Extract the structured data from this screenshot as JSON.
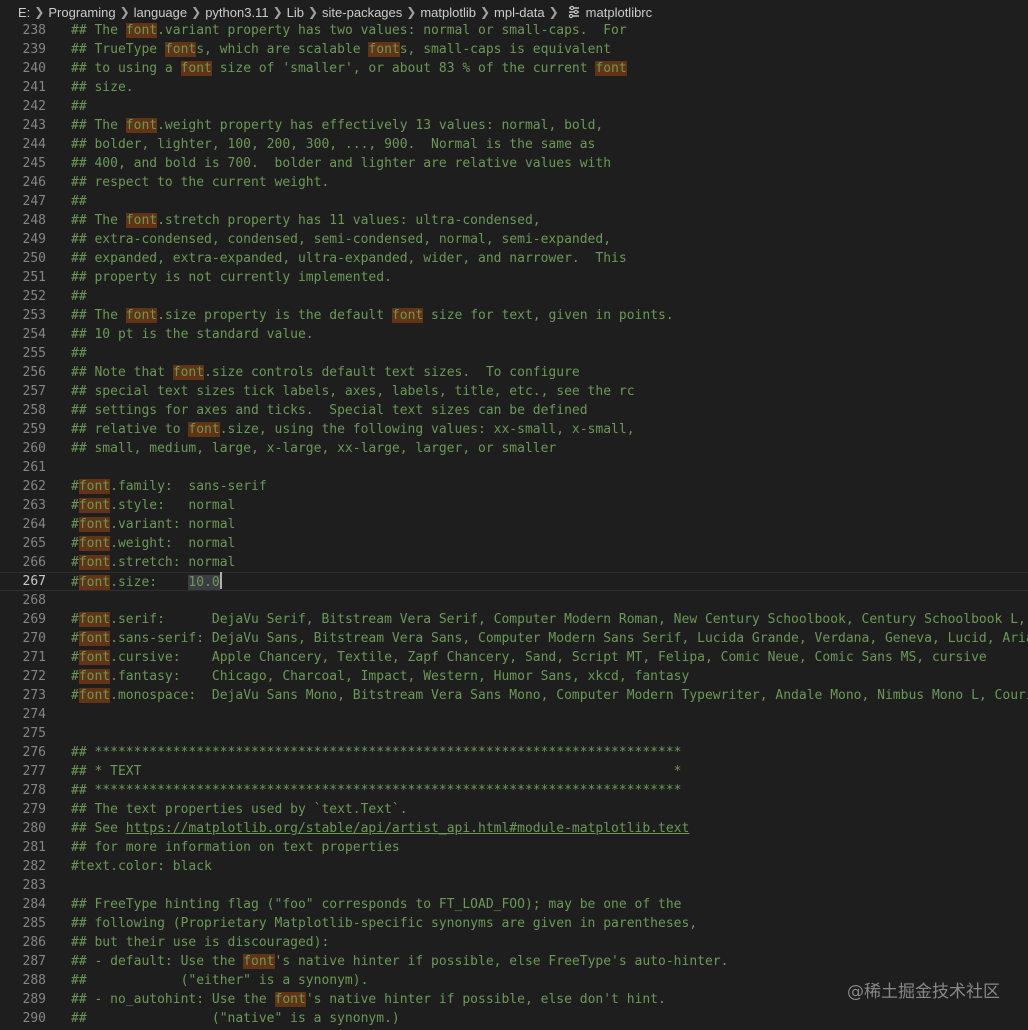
{
  "breadcrumb": {
    "items": [
      "E:",
      "Programing",
      "language",
      "python3.11",
      "Lib",
      "site-packages",
      "matplotlib",
      "mpl-data",
      "matplotlibrc"
    ]
  },
  "editor": {
    "current_line": 267,
    "lines": [
      {
        "n": 238,
        "segs": [
          [
            "## The "
          ],
          [
            "font",
            "hl"
          ],
          [
            ".variant property has two values: normal or small-caps.  For"
          ]
        ]
      },
      {
        "n": 239,
        "segs": [
          [
            "## TrueType "
          ],
          [
            "font",
            "hl"
          ],
          [
            "s, which are scalable "
          ],
          [
            "font",
            "hl"
          ],
          [
            "s, small-caps is equivalent"
          ]
        ]
      },
      {
        "n": 240,
        "segs": [
          [
            "## to using a "
          ],
          [
            "font",
            "hl"
          ],
          [
            " size of 'smaller', or about 83 % of the current "
          ],
          [
            "font",
            "hl"
          ]
        ]
      },
      {
        "n": 241,
        "segs": [
          [
            "## size."
          ]
        ],
        "mark": true
      },
      {
        "n": 242,
        "segs": [
          [
            "##"
          ]
        ]
      },
      {
        "n": 243,
        "segs": [
          [
            "## The "
          ],
          [
            "font",
            "hl"
          ],
          [
            ".weight property has effectively 13 values: normal, bold,"
          ]
        ]
      },
      {
        "n": 244,
        "segs": [
          [
            "## bolder, lighter, 100, 200, 300, ..., 900.  Normal is the same as"
          ]
        ]
      },
      {
        "n": 245,
        "segs": [
          [
            "## 400, and bold is 700.  bolder and lighter are relative values with"
          ]
        ]
      },
      {
        "n": 246,
        "segs": [
          [
            "## respect to the current weight."
          ]
        ]
      },
      {
        "n": 247,
        "segs": [
          [
            "##"
          ]
        ]
      },
      {
        "n": 248,
        "segs": [
          [
            "## The "
          ],
          [
            "font",
            "hl"
          ],
          [
            ".stretch property has 11 values: ultra-condensed,"
          ]
        ]
      },
      {
        "n": 249,
        "segs": [
          [
            "## extra-condensed, condensed, semi-condensed, normal, semi-expanded,"
          ]
        ]
      },
      {
        "n": 250,
        "segs": [
          [
            "## expanded, extra-expanded, ultra-expanded, wider, and narrower.  This"
          ]
        ]
      },
      {
        "n": 251,
        "segs": [
          [
            "## property is not currently implemented."
          ]
        ]
      },
      {
        "n": 252,
        "segs": [
          [
            "##"
          ]
        ]
      },
      {
        "n": 253,
        "segs": [
          [
            "## The "
          ],
          [
            "font",
            "hl"
          ],
          [
            ".size property is the default "
          ],
          [
            "font",
            "hl"
          ],
          [
            " size for text, given in points."
          ]
        ]
      },
      {
        "n": 254,
        "segs": [
          [
            "## 10 pt is the standard value."
          ]
        ]
      },
      {
        "n": 255,
        "segs": [
          [
            "##"
          ]
        ]
      },
      {
        "n": 256,
        "segs": [
          [
            "## Note that "
          ],
          [
            "font",
            "hl"
          ],
          [
            ".size controls default text sizes.  To configure"
          ]
        ]
      },
      {
        "n": 257,
        "segs": [
          [
            "## special text sizes tick labels, axes, labels, title, etc., see the rc"
          ]
        ]
      },
      {
        "n": 258,
        "segs": [
          [
            "## settings for axes and ticks.  Special text sizes can be defined"
          ]
        ]
      },
      {
        "n": 259,
        "segs": [
          [
            "## relative to "
          ],
          [
            "font",
            "hl"
          ],
          [
            ".size, using the following values: xx-small, x-small,"
          ]
        ]
      },
      {
        "n": 260,
        "segs": [
          [
            "## small, medium, large, x-large, xx-large, larger, or smaller"
          ]
        ]
      },
      {
        "n": 261,
        "segs": [
          [
            ""
          ]
        ]
      },
      {
        "n": 262,
        "segs": [
          [
            "#"
          ],
          [
            "font",
            "hl"
          ],
          [
            ".family:  sans-serif"
          ]
        ]
      },
      {
        "n": 263,
        "segs": [
          [
            "#"
          ],
          [
            "font",
            "hl"
          ],
          [
            ".style:   normal"
          ]
        ]
      },
      {
        "n": 264,
        "segs": [
          [
            "#"
          ],
          [
            "font",
            "hl"
          ],
          [
            ".variant: normal"
          ]
        ]
      },
      {
        "n": 265,
        "segs": [
          [
            "#"
          ],
          [
            "font",
            "hl"
          ],
          [
            ".weight:  normal"
          ]
        ]
      },
      {
        "n": 266,
        "segs": [
          [
            "#"
          ],
          [
            "font",
            "hl"
          ],
          [
            ".stretch: normal"
          ]
        ]
      },
      {
        "n": 267,
        "segs": [
          [
            "#"
          ],
          [
            "font",
            "hl"
          ],
          [
            ".size:    "
          ],
          [
            "10.0",
            "sel"
          ],
          [
            "",
            "cursor"
          ]
        ]
      },
      {
        "n": 268,
        "segs": [
          [
            ""
          ]
        ]
      },
      {
        "n": 269,
        "segs": [
          [
            "#"
          ],
          [
            "font",
            "hl"
          ],
          [
            ".serif:      DejaVu Serif, Bitstream Vera Serif, Computer Modern Roman, New Century Schoolbook, Century Schoolbook L, Ut"
          ]
        ]
      },
      {
        "n": 270,
        "segs": [
          [
            "#"
          ],
          [
            "font",
            "hl"
          ],
          [
            ".sans-serif: DejaVu Sans, Bitstream Vera Sans, Computer Modern Sans Serif, Lucida Grande, Verdana, Geneva, Lucid, Arial,"
          ]
        ]
      },
      {
        "n": 271,
        "segs": [
          [
            "#"
          ],
          [
            "font",
            "hl"
          ],
          [
            ".cursive:    Apple Chancery, Textile, Zapf Chancery, Sand, Script MT, Felipa, Comic Neue, Comic Sans MS, cursive"
          ]
        ]
      },
      {
        "n": 272,
        "segs": [
          [
            "#"
          ],
          [
            "font",
            "hl"
          ],
          [
            ".fantasy:    Chicago, Charcoal, Impact, Western, Humor Sans, xkcd, fantasy"
          ]
        ]
      },
      {
        "n": 273,
        "segs": [
          [
            "#"
          ],
          [
            "font",
            "hl"
          ],
          [
            ".monospace:  DejaVu Sans Mono, Bitstream Vera Sans Mono, Computer Modern Typewriter, Andale Mono, Nimbus Mono L, Courier"
          ]
        ]
      },
      {
        "n": 274,
        "segs": [
          [
            ""
          ]
        ]
      },
      {
        "n": 275,
        "segs": [
          [
            ""
          ]
        ]
      },
      {
        "n": 276,
        "segs": [
          [
            "## ***************************************************************************"
          ]
        ]
      },
      {
        "n": 277,
        "segs": [
          [
            "## * TEXT                                                                    *"
          ]
        ]
      },
      {
        "n": 278,
        "segs": [
          [
            "## ***************************************************************************"
          ]
        ]
      },
      {
        "n": 279,
        "segs": [
          [
            "## The text properties used by `text.Text`."
          ]
        ]
      },
      {
        "n": 280,
        "segs": [
          [
            "## See "
          ],
          [
            "https://matplotlib.org/stable/api/artist_api.html#module-matplotlib.text",
            "link"
          ]
        ]
      },
      {
        "n": 281,
        "segs": [
          [
            "## for more information on text properties"
          ]
        ]
      },
      {
        "n": 282,
        "segs": [
          [
            "#text.color: black"
          ]
        ]
      },
      {
        "n": 283,
        "segs": [
          [
            ""
          ]
        ]
      },
      {
        "n": 284,
        "segs": [
          [
            "## FreeType hinting flag (\"foo\" corresponds to FT_LOAD_FOO); may be one of the"
          ]
        ]
      },
      {
        "n": 285,
        "segs": [
          [
            "## following (Proprietary Matplotlib-specific synonyms are given in parentheses,"
          ]
        ]
      },
      {
        "n": 286,
        "segs": [
          [
            "## but their use is discouraged):"
          ]
        ]
      },
      {
        "n": 287,
        "segs": [
          [
            "## - default: Use the "
          ],
          [
            "font",
            "hl"
          ],
          [
            "'s native hinter if possible, else FreeType's auto-hinter."
          ]
        ]
      },
      {
        "n": 288,
        "segs": [
          [
            "##            (\"either\" is a synonym)."
          ]
        ]
      },
      {
        "n": 289,
        "segs": [
          [
            "## - no_autohint: Use the "
          ],
          [
            "font",
            "hl"
          ],
          [
            "'s native hinter if possible, else don't hint."
          ]
        ]
      },
      {
        "n": 290,
        "segs": [
          [
            "##                (\"native\" is a synonym.)"
          ]
        ]
      }
    ]
  },
  "watermark": "@稀土掘金技术社区",
  "colors": {
    "background": "#1e1e1e",
    "comment": "#6a9955",
    "line_number": "#858585",
    "find_highlight": "#623315",
    "selection": "#3a3d41"
  }
}
